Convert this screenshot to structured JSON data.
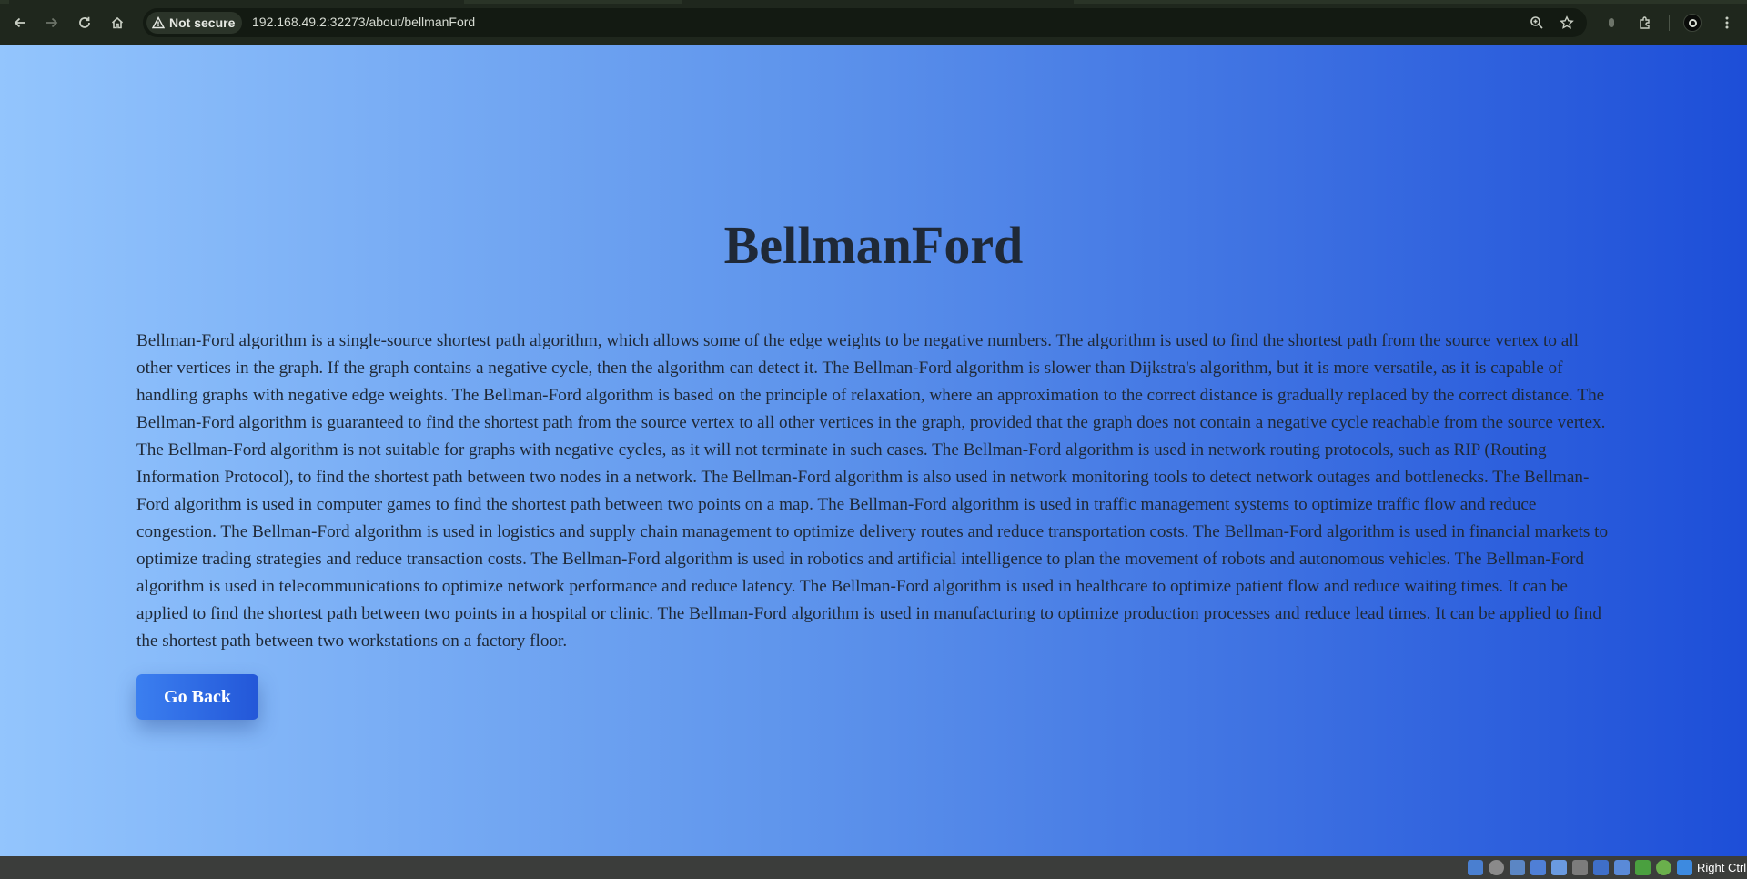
{
  "browser": {
    "security_label": "Not secure",
    "url": "192.168.49.2:32273/about/bellmanFord",
    "icons": [
      "back-icon",
      "forward-icon",
      "reload-icon",
      "home-icon",
      "warning-icon",
      "zoom-icon",
      "star-icon",
      "extension-icon",
      "puzzle-icon",
      "profile-icon",
      "menu-icon"
    ]
  },
  "page": {
    "title": "BellmanFord",
    "description": "Bellman-Ford algorithm is a single-source shortest path algorithm, which allows some of the edge weights to be negative numbers. The algorithm is used to find the shortest path from the source vertex to all other vertices in the graph. If the graph contains a negative cycle, then the algorithm can detect it. The Bellman-Ford algorithm is slower than Dijkstra's algorithm, but it is more versatile, as it is capable of handling graphs with negative edge weights. The Bellman-Ford algorithm is based on the principle of relaxation, where an approximation to the correct distance is gradually replaced by the correct distance. The Bellman-Ford algorithm is guaranteed to find the shortest path from the source vertex to all other vertices in the graph, provided that the graph does not contain a negative cycle reachable from the source vertex. The Bellman-Ford algorithm is not suitable for graphs with negative cycles, as it will not terminate in such cases. The Bellman-Ford algorithm is used in network routing protocols, such as RIP (Routing Information Protocol), to find the shortest path between two nodes in a network. The Bellman-Ford algorithm is also used in network monitoring tools to detect network outages and bottlenecks. The Bellman-Ford algorithm is used in computer games to find the shortest path between two points on a map. The Bellman-Ford algorithm is used in traffic management systems to optimize traffic flow and reduce congestion. The Bellman-Ford algorithm is used in logistics and supply chain management to optimize delivery routes and reduce transportation costs. The Bellman-Ford algorithm is used in financial markets to optimize trading strategies and reduce transaction costs. The Bellman-Ford algorithm is used in robotics and artificial intelligence to plan the movement of robots and autonomous vehicles. The Bellman-Ford algorithm is used in telecommunications to optimize network performance and reduce latency. The Bellman-Ford algorithm is used in healthcare to optimize patient flow and reduce waiting times. It can be applied to find the shortest path between two points in a hospital or clinic. The Bellman-Ford algorithm is used in manufacturing to optimize production processes and reduce lead times. It can be applied to find the shortest path between two workstations on a factory floor.",
    "go_back_label": "Go Back",
    "colors": {
      "gradient_start": "#93c5fd",
      "gradient_end": "#1d4ed8",
      "text": "#1f2937",
      "button": "#2563eb"
    }
  },
  "taskbar": {
    "keyboard_label": "Right Ctrl"
  }
}
